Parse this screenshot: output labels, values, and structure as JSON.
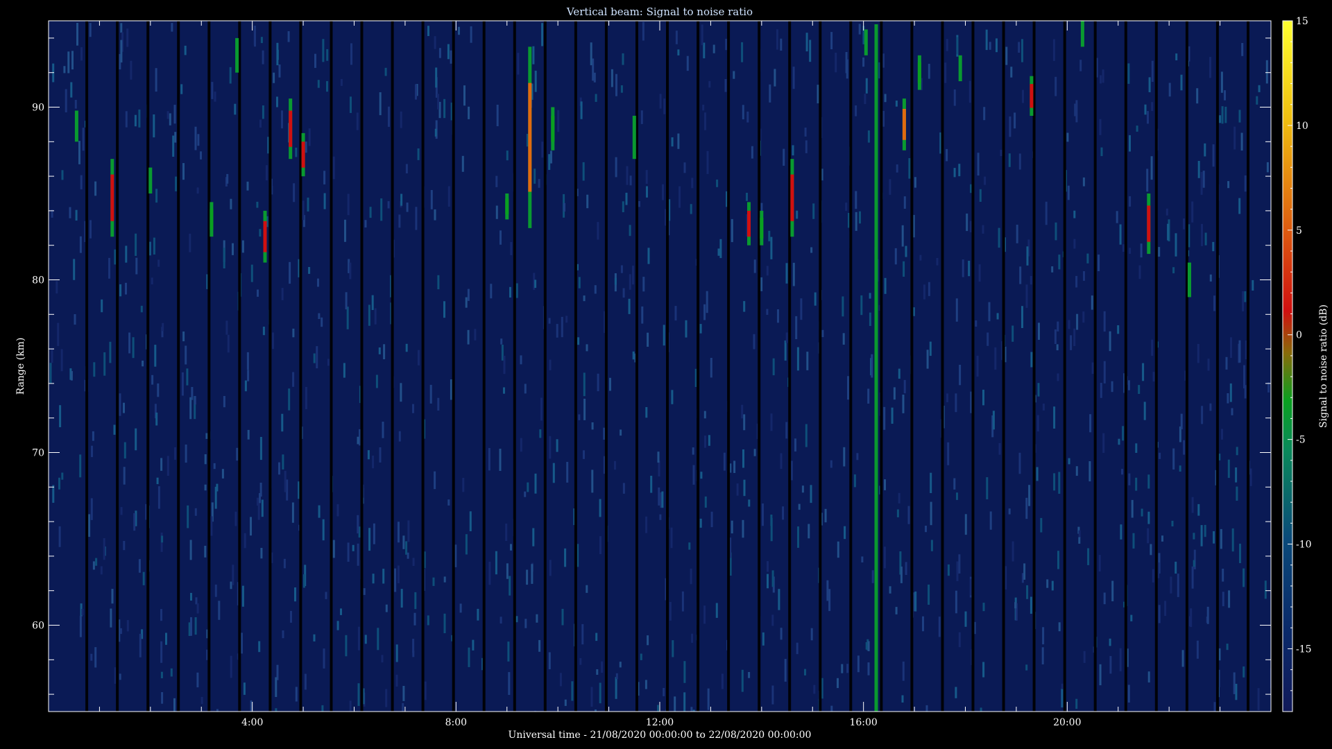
{
  "chart_data": {
    "type": "heatmap",
    "title": "Vertical beam: Signal to noise ratio",
    "xlabel": "Universal time - 21/08/2020 00:00:00 to 22/08/2020 00:00:00",
    "ylabel": "Range (km)",
    "colorbar_label": "Signal to noise ratio (dB)",
    "xlim": [
      0,
      24
    ],
    "ylim": [
      55,
      95
    ],
    "x_ticks": [
      {
        "value": 4,
        "label": "4:00"
      },
      {
        "value": 8,
        "label": "8:00"
      },
      {
        "value": 12,
        "label": "12:00"
      },
      {
        "value": 16,
        "label": "16:00"
      },
      {
        "value": 20,
        "label": "20:00"
      }
    ],
    "y_ticks": [
      {
        "value": 60,
        "label": "60"
      },
      {
        "value": 70,
        "label": "70"
      },
      {
        "value": 80,
        "label": "80"
      },
      {
        "value": 90,
        "label": "90"
      }
    ],
    "colorbar_range": [
      -18,
      15
    ],
    "colorbar_ticks": [
      {
        "value": 15,
        "label": "15"
      },
      {
        "value": 10,
        "label": "10"
      },
      {
        "value": 5,
        "label": "5"
      },
      {
        "value": 0,
        "label": "0"
      },
      {
        "value": -5,
        "label": "-5"
      },
      {
        "value": -10,
        "label": "-10"
      },
      {
        "value": -15,
        "label": "-15"
      }
    ],
    "colors": {
      "background": "#0a1a55",
      "colormap": [
        "#121a5a",
        "#0a3a7a",
        "#0a7a6a",
        "#0a9a20",
        "#8a7a0a",
        "#d01010",
        "#e06a10",
        "#f0d010",
        "#ffff20"
      ]
    },
    "noise_level_db": -15,
    "gap_times_h": [
      0.75,
      1.35,
      1.95,
      2.55,
      3.15,
      3.75,
      4.35,
      4.95,
      5.55,
      6.15,
      6.75,
      7.35,
      7.95,
      8.55,
      9.15,
      9.75,
      10.35,
      10.95,
      11.55,
      12.15,
      12.75,
      13.35,
      13.95,
      14.55,
      15.15,
      15.75,
      16.35,
      16.95,
      17.55,
      18.15,
      18.75,
      19.35,
      19.95,
      20.55,
      21.15,
      21.75,
      22.35,
      22.95,
      23.55
    ],
    "echoes": [
      {
        "time_h": 0.55,
        "range_km": [
          88.0,
          89.8
        ],
        "snr_db": -7
      },
      {
        "time_h": 1.25,
        "range_km": [
          82.5,
          87.0
        ],
        "snr_db": 0
      },
      {
        "time_h": 2.0,
        "range_km": [
          85.0,
          86.5
        ],
        "snr_db": -12
      },
      {
        "time_h": 3.2,
        "range_km": [
          82.5,
          84.5
        ],
        "snr_db": -5
      },
      {
        "time_h": 3.7,
        "range_km": [
          92.0,
          94.0
        ],
        "snr_db": -8
      },
      {
        "time_h": 4.25,
        "range_km": [
          81.0,
          84.0
        ],
        "snr_db": 1
      },
      {
        "time_h": 4.75,
        "range_km": [
          87.0,
          90.5
        ],
        "snr_db": 0
      },
      {
        "time_h": 5.0,
        "range_km": [
          86.0,
          88.5
        ],
        "snr_db": 1
      },
      {
        "time_h": 9.0,
        "range_km": [
          83.5,
          85.0
        ],
        "snr_db": -6
      },
      {
        "time_h": 9.45,
        "range_km": [
          83.0,
          93.5
        ],
        "snr_db": 4
      },
      {
        "time_h": 9.9,
        "range_km": [
          87.5,
          90.0
        ],
        "snr_db": -6
      },
      {
        "time_h": 11.5,
        "range_km": [
          87.0,
          89.5
        ],
        "snr_db": -7
      },
      {
        "time_h": 13.75,
        "range_km": [
          82.0,
          84.5
        ],
        "snr_db": 1
      },
      {
        "time_h": 14.0,
        "range_km": [
          82.0,
          84.0
        ],
        "snr_db": -6
      },
      {
        "time_h": 14.6,
        "range_km": [
          82.5,
          87.0
        ],
        "snr_db": 2
      },
      {
        "time_h": 16.05,
        "range_km": [
          93.0,
          94.5
        ],
        "snr_db": -7
      },
      {
        "time_h": 16.25,
        "range_km": [
          55.0,
          94.8
        ],
        "snr_db": -8
      },
      {
        "time_h": 16.8,
        "range_km": [
          87.5,
          90.5
        ],
        "snr_db": 5
      },
      {
        "time_h": 17.1,
        "range_km": [
          91.0,
          93.0
        ],
        "snr_db": -6
      },
      {
        "time_h": 17.9,
        "range_km": [
          91.5,
          93.0
        ],
        "snr_db": -7
      },
      {
        "time_h": 19.3,
        "range_km": [
          89.5,
          91.8
        ],
        "snr_db": 1
      },
      {
        "time_h": 20.3,
        "range_km": [
          93.5,
          95.0
        ],
        "snr_db": -8
      },
      {
        "time_h": 21.6,
        "range_km": [
          81.5,
          85.0
        ],
        "snr_db": 2
      },
      {
        "time_h": 22.4,
        "range_km": [
          79.0,
          81.0
        ],
        "snr_db": -7
      }
    ]
  }
}
